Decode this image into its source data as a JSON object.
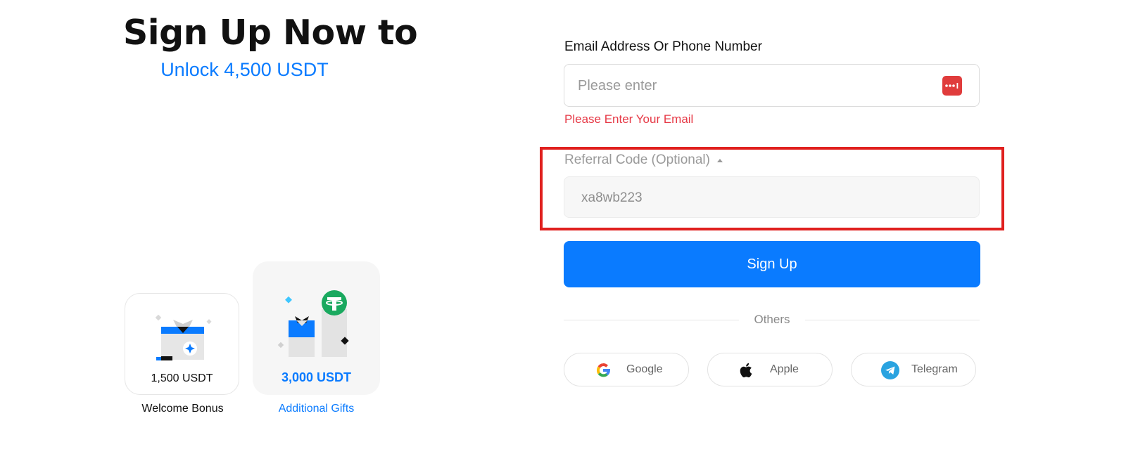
{
  "hero": {
    "title": "Sign Up Now to",
    "subtitle": "Unlock 4,500 USDT"
  },
  "rewards": [
    {
      "amount": "1,500 USDT",
      "caption": "Welcome Bonus"
    },
    {
      "amount": "3,000 USDT",
      "caption": "Additional Gifts"
    }
  ],
  "form": {
    "email_label": "Email Address Or Phone Number",
    "email_placeholder": "Please enter",
    "email_value": "",
    "email_error": "Please Enter Your Email",
    "referral_label": "Referral Code (Optional)",
    "referral_value": "xa8wb223",
    "submit_label": "Sign Up"
  },
  "others": {
    "divider_label": "Others",
    "providers": [
      {
        "label": "Google",
        "icon": "google-icon"
      },
      {
        "label": "Apple",
        "icon": "apple-icon"
      },
      {
        "label": "Telegram",
        "icon": "telegram-icon"
      }
    ]
  },
  "colors": {
    "accent": "#0a7bff",
    "error": "#e63946",
    "highlight": "#e0201e",
    "tether": "#1aa95f"
  }
}
